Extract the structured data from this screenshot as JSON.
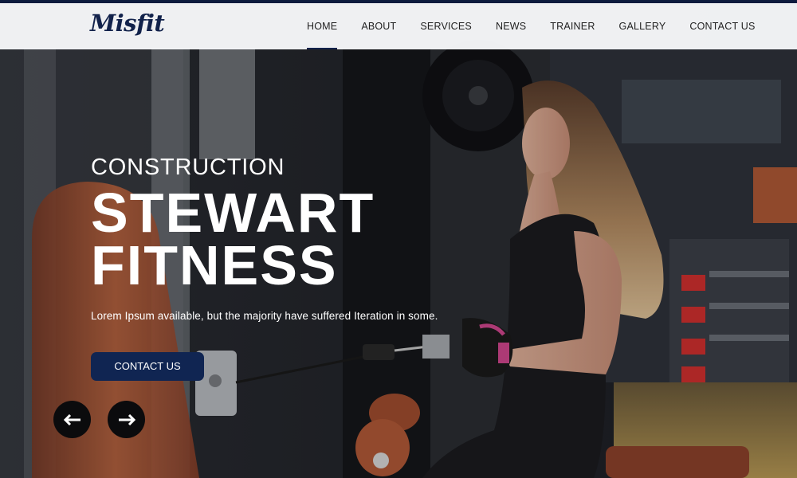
{
  "brand": {
    "logo": "Misfit"
  },
  "nav": {
    "items": [
      {
        "label": "HOME",
        "active": true
      },
      {
        "label": "ABOUT"
      },
      {
        "label": "SERVICES"
      },
      {
        "label": "NEWS"
      },
      {
        "label": "TRAINER"
      },
      {
        "label": "GALLERY"
      },
      {
        "label": "CONTACT US"
      }
    ]
  },
  "hero": {
    "subtitle": "CONSTRUCTION",
    "title_line1": "STEWART",
    "title_line2": "FITNESS",
    "description": "Lorem Ipsum available, but the majority have suffered Iteration in some.",
    "cta_label": "CONTACT US",
    "prev_icon": "arrow-left-icon",
    "next_icon": "arrow-right-icon"
  },
  "colors": {
    "brand": "#102552",
    "nav_text": "#222222",
    "hero_text": "#ffffff"
  }
}
